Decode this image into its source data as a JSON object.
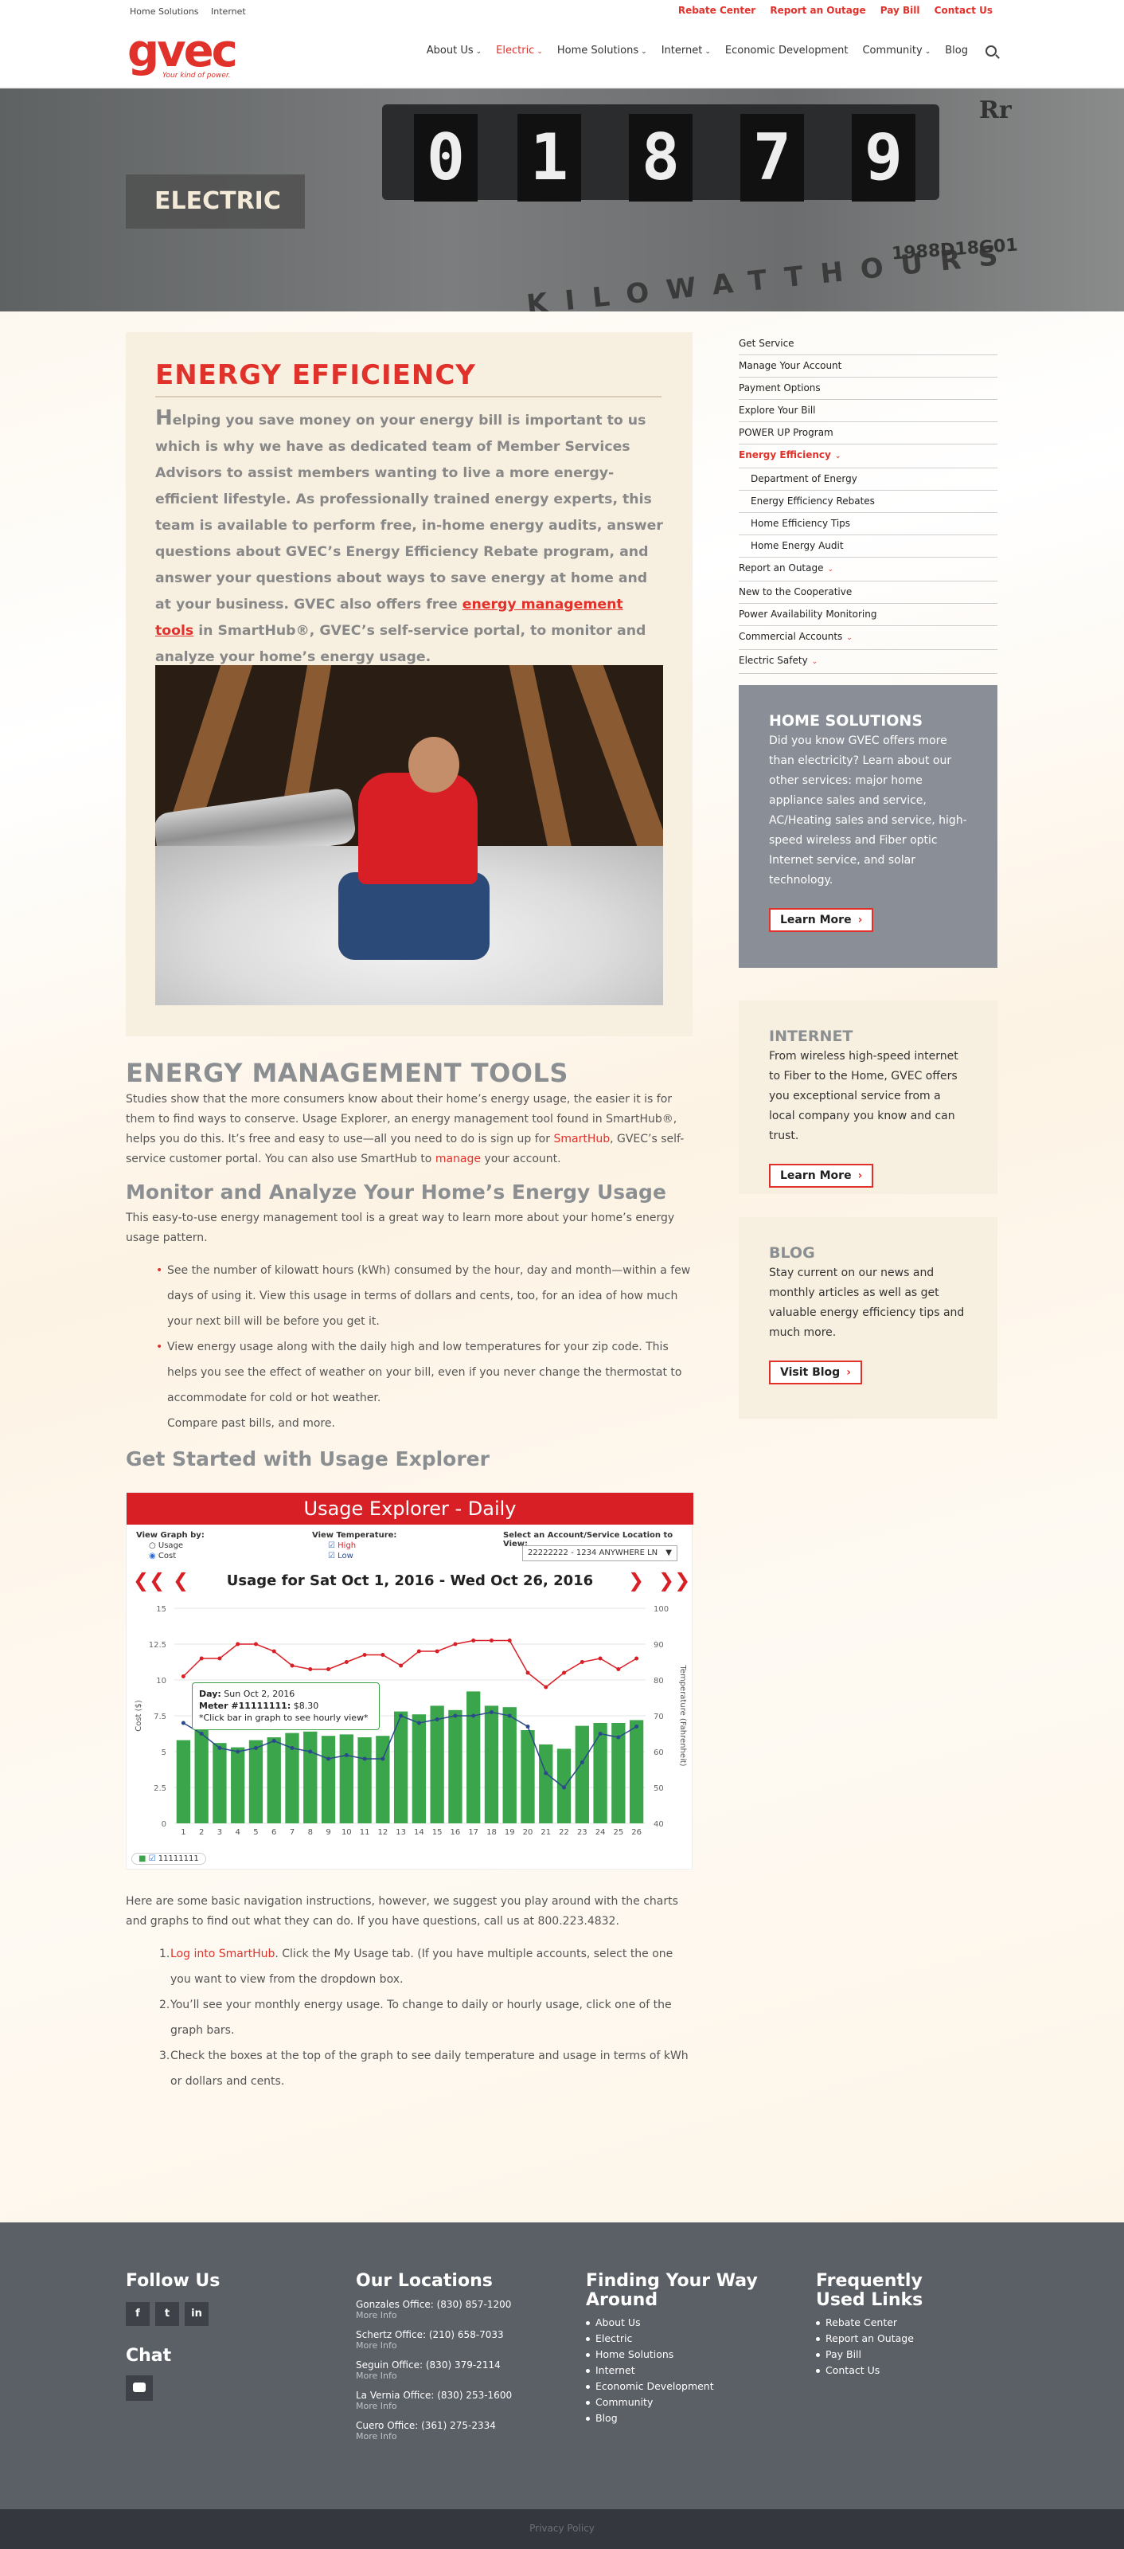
{
  "topbar": {
    "left_links": [
      "Home Solutions",
      "Internet"
    ],
    "right_links": [
      "Rebate Center",
      "Report an Outage",
      "Pay Bill",
      "Contact Us"
    ]
  },
  "logo": {
    "word": "gvec",
    "tagline": "Your kind of power."
  },
  "nav": {
    "items": [
      {
        "label": "About Us",
        "dropdown": true
      },
      {
        "label": "Electric",
        "dropdown": true,
        "active": true
      },
      {
        "label": "Home Solutions",
        "dropdown": true
      },
      {
        "label": "Internet",
        "dropdown": true
      },
      {
        "label": "Economic Development",
        "dropdown": false
      },
      {
        "label": "Community",
        "dropdown": true
      },
      {
        "label": "Blog",
        "dropdown": false
      }
    ],
    "search_icon": "search-icon"
  },
  "hero": {
    "title": "ELECTRIC",
    "meter_digits": [
      "0",
      "1",
      "8",
      "7",
      "9"
    ],
    "meter_word": "KILOWATTHOURS",
    "meter_serial": "1988D18G01",
    "meter_rr": "Rr"
  },
  "energy_efficiency": {
    "title": "ENERGY EFFICIENCY",
    "dropcap": "H",
    "lead_before_link": "elping you save money on your energy bill is important to us which is why we have as dedicated team of Member Services Advisors to assist members wanting to live a more energy-efficient lifestyle. As professionally trained energy experts, this team is available to perform free, in-home energy audits, answer questions about GVEC’s Energy Efficiency Rebate program, and answer your questions about ways to save energy at home and at your business. GVEC also offers free ",
    "lead_link": "energy management tools",
    "lead_after_link": " in SmartHub®, GVEC’s self-service portal, to monitor and analyze your home’s energy usage."
  },
  "tools": {
    "title": "ENERGY MANAGEMENT TOOLS",
    "p1_a": "Studies show that the more consumers know about their home’s energy usage, the easier it is for them to find ways to conserve. Usage Explorer, an energy management tool found in SmartHub®, helps you do this. It’s free and easy to use—all you need to do is sign up for ",
    "p1_link1": "SmartHub",
    "p1_b": ", GVEC’s self-service customer portal. You can also use SmartHub to ",
    "p1_link2": "manage",
    "p1_c": " your account.",
    "h_monitor": "Monitor and Analyze Your Home’s Energy Usage",
    "p2": "This easy-to-use energy management tool is a great way to learn more about your home’s energy usage pattern.",
    "bullets": [
      "See the number of kilowatt hours (kWh) consumed by the hour, day and month—within a few days of using it. View this usage in terms of dollars and cents, too, for an idea of how much your next bill will be before you get it.",
      "View energy usage along with the daily high and low temperatures for your zip code. This helps you see the effect of weather on your bill, even if you never change the thermostat to accommodate for cold or hot weather."
    ],
    "bullet_tail": "Compare past bills, and more.",
    "h_started": "Get Started with Usage Explorer",
    "p3": "Here are some basic navigation instructions, however, we suggest you play around with the charts and graphs to find out what they can do. If you have questions, call us at 800.223.4832.",
    "steps": [
      {
        "num": "1.",
        "link": "Log into SmartHub",
        "text": ". Click the My Usage tab. (If you  have multiple accounts, select the one you want to view from the dropdown box."
      },
      {
        "num": "2.",
        "link": "",
        "text": "You’ll see your monthly energy usage. To change to daily or hourly usage, click one of the graph bars."
      },
      {
        "num": "3.",
        "link": "",
        "text": "Check the boxes at the top of the graph to see daily temperature and usage in terms of kWh or dollars and cents."
      }
    ]
  },
  "usage_explorer": {
    "header": "Usage Explorer - Daily",
    "view_graph_by": "View Graph by:",
    "opt_usage": "Usage",
    "opt_cost": "Cost",
    "view_temp": "View Temperature:",
    "opt_high": "High",
    "opt_low": "Low",
    "select_label": "Select an Account/Service Location to View:",
    "select_value": "22222222  -  1234 ANYWHERE LN",
    "range_title": "Usage for Sat Oct 1, 2016  -  Wed Oct 26, 2016",
    "tooltip_day_label": "Day:",
    "tooltip_day": "Sun Oct 2, 2016",
    "tooltip_meter_label": "Meter #11111111:",
    "tooltip_meter": "$8.30",
    "tooltip_hint": "*Click bar in graph to see hourly view*",
    "legend": "11111111"
  },
  "chart_data": {
    "type": "bar",
    "title": "Usage for Sat Oct 1, 2016  -  Wed Oct 26, 2016",
    "ylabel": "Cost ($)",
    "y2label": "Temperature (Fahrenheit)",
    "ylim": [
      0,
      15
    ],
    "y2lim": [
      40,
      100
    ],
    "yticks": [
      "0",
      "2.5",
      "5",
      "7.5",
      "10",
      "12.5",
      "15"
    ],
    "y2ticks": [
      "40",
      "50",
      "60",
      "70",
      "80",
      "90",
      "100"
    ],
    "categories": [
      "1",
      "2",
      "3",
      "4",
      "5",
      "6",
      "7",
      "8",
      "9",
      "10",
      "11",
      "12",
      "13",
      "14",
      "15",
      "16",
      "17",
      "18",
      "19",
      "20",
      "21",
      "22",
      "23",
      "24",
      "25",
      "26"
    ],
    "series": [
      {
        "name": "11111111",
        "kind": "bar",
        "color": "#3aa54a",
        "values": [
          5.8,
          8.3,
          5.6,
          5.3,
          5.8,
          6.0,
          6.3,
          6.4,
          6.1,
          6.2,
          6.0,
          6.1,
          7.8,
          7.6,
          8.2,
          7.9,
          9.2,
          8.2,
          8.1,
          6.5,
          5.5,
          5.2,
          6.8,
          7.0,
          7.0,
          7.2
        ],
        "bars_y_axis": "Cost ($)"
      },
      {
        "name": "High",
        "kind": "line",
        "color": "#d91f26",
        "values": [
          81,
          86,
          86,
          90,
          90,
          88,
          84,
          83,
          83,
          85,
          87,
          87,
          84,
          88,
          88,
          90,
          91,
          91,
          91,
          82,
          78,
          82,
          85,
          86,
          83,
          86
        ]
      },
      {
        "name": "Low",
        "kind": "line",
        "color": "#2b4a8b",
        "values": [
          68,
          65,
          61,
          60,
          61,
          63,
          61,
          60,
          58,
          59,
          58,
          58,
          70,
          68,
          69,
          70,
          70,
          71,
          70,
          67,
          54,
          50,
          57,
          65,
          64,
          67
        ]
      }
    ],
    "grid": true
  },
  "sidebar": {
    "items": [
      {
        "label": "Get Service",
        "sub": false,
        "active": false,
        "dropdown": false
      },
      {
        "label": "Manage Your Account",
        "sub": false,
        "active": false,
        "dropdown": false
      },
      {
        "label": "Payment Options",
        "sub": false,
        "active": false,
        "dropdown": false
      },
      {
        "label": "Explore Your Bill",
        "sub": false,
        "active": false,
        "dropdown": false
      },
      {
        "label": "POWER UP Program",
        "sub": false,
        "active": false,
        "dropdown": false
      },
      {
        "label": "Energy Efficiency",
        "sub": false,
        "active": true,
        "dropdown": true
      },
      {
        "label": "Department of Energy",
        "sub": true,
        "active": false,
        "dropdown": false
      },
      {
        "label": "Energy Efficiency Rebates",
        "sub": true,
        "active": false,
        "dropdown": false
      },
      {
        "label": "Home Efficiency Tips",
        "sub": true,
        "active": false,
        "dropdown": false
      },
      {
        "label": "Home Energy Audit",
        "sub": true,
        "active": false,
        "dropdown": false
      },
      {
        "label": "Report an Outage",
        "sub": false,
        "active": false,
        "dropdown": true
      },
      {
        "label": "New to the Cooperative",
        "sub": false,
        "active": false,
        "dropdown": false
      },
      {
        "label": "Power Availability Monitoring",
        "sub": false,
        "active": false,
        "dropdown": false
      },
      {
        "label": "Commercial Accounts",
        "sub": false,
        "active": false,
        "dropdown": true
      },
      {
        "label": "Electric Safety",
        "sub": false,
        "active": false,
        "dropdown": true
      }
    ]
  },
  "widgets": {
    "home": {
      "title": "HOME SOLUTIONS",
      "text": "Did you know GVEC offers more than electricity? Learn about our other services: major home appliance sales and service, AC/Heating sales and service, high-speed wireless and Fiber optic Internet service, and solar technology.",
      "button": "Learn More"
    },
    "internet": {
      "title": "INTERNET",
      "text": "From wireless high-speed internet to Fiber to the Home, GVEC offers you exceptional service from a local company you know and can trust.",
      "button": "Learn More"
    },
    "blog": {
      "title": "BLOG",
      "text": "Stay current on our news and monthly articles as well as get valuable energy efficiency tips and much more.",
      "button": "Visit Blog"
    }
  },
  "footer": {
    "follow_title": "Follow Us",
    "social": [
      "f",
      "t",
      "in"
    ],
    "chat_title": "Chat",
    "locations_title": "Our Locations",
    "locations": [
      {
        "name": "Gonzales Office: (830) 857-1200",
        "more": "More Info"
      },
      {
        "name": "Schertz Office: (210) 658-7033",
        "more": "More Info"
      },
      {
        "name": "Seguin Office: (830) 379-2114",
        "more": "More Info"
      },
      {
        "name": "La Vernia Office: (830) 253-1600",
        "more": "More Info"
      },
      {
        "name": "Cuero Office: (361) 275-2334",
        "more": "More Info"
      }
    ],
    "finding_title": "Finding Your Way Around",
    "finding": [
      "About Us",
      "Electric",
      "Home Solutions",
      "Internet",
      "Economic Development",
      "Community",
      "Blog"
    ],
    "frequent_title": "Frequently Used Links",
    "frequent": [
      "Rebate Center",
      "Report an Outage",
      "Pay Bill",
      "Contact Us"
    ],
    "privacy": "Privacy Policy"
  },
  "colors": {
    "brand_red": "#e0312b",
    "footer_bg": "#5b5f66",
    "widget_gray": "#8a8e96",
    "widget_cream": "#f7efdf"
  }
}
